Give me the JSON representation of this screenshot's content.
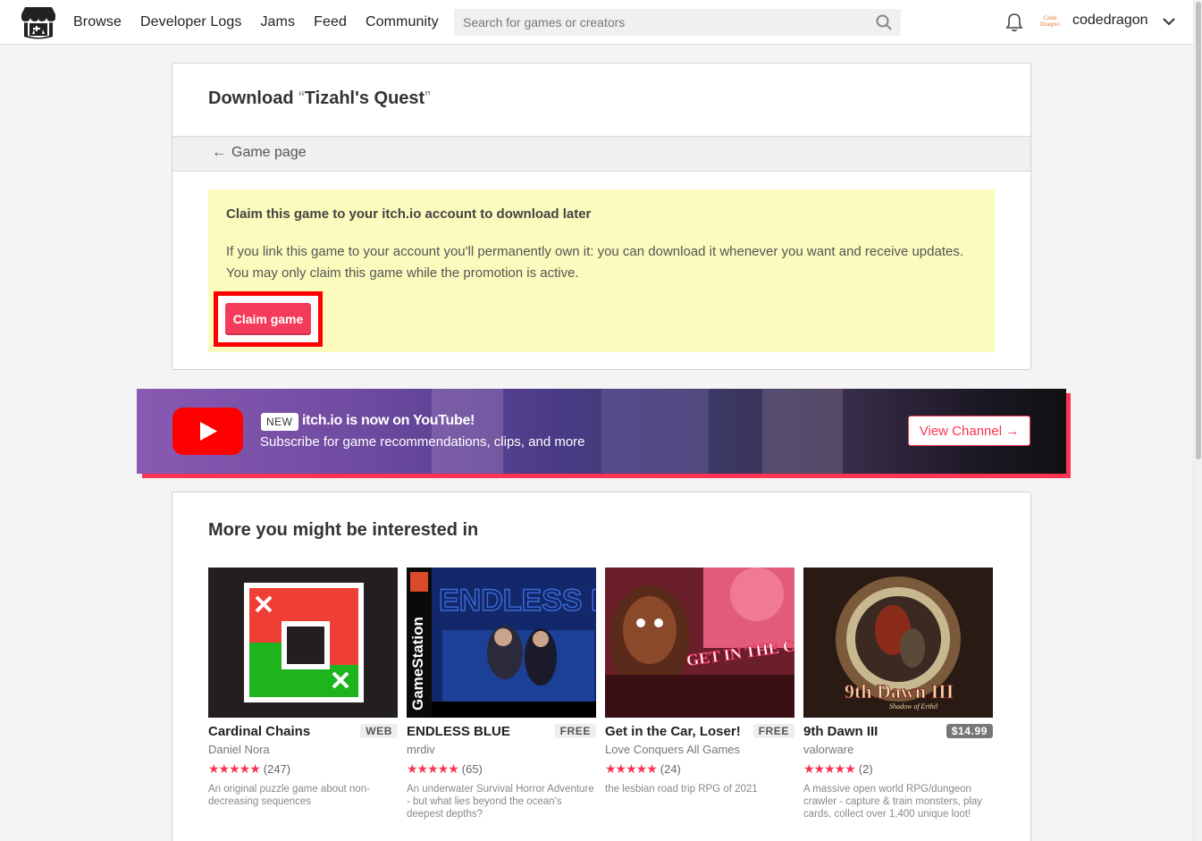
{
  "header": {
    "nav": [
      "Browse",
      "Developer Logs",
      "Jams",
      "Feed",
      "Community"
    ],
    "search_placeholder": "Search for games or creators",
    "avatar_text": "Code Dragon",
    "username": "codedragon"
  },
  "download": {
    "title_prefix": "Download",
    "open_quote": "“",
    "game_name": "Tizahl's Quest",
    "close_quote": "”",
    "back_label": "Game page",
    "claim_heading": "Claim this game to your itch.io account to download later",
    "claim_text": "If you link this game to your account you'll permanently own it: you can download it whenever you want and receive updates. You may only claim this game while the promotion is active.",
    "claim_button": "Claim game"
  },
  "youtube": {
    "badge": "NEW",
    "title": "itch.io is now on YouTube!",
    "subtitle": "Subscribe for game recommendations, clips, and more",
    "button": "View Channel →"
  },
  "recommendations": {
    "title": "More you might be interested in",
    "games": [
      {
        "title": "Cardinal Chains",
        "tag": "WEB",
        "author": "Daniel Nora",
        "rating_count": "(247)",
        "description": "An original puzzle game about non-decreasing sequences"
      },
      {
        "title": "ENDLESS BLUE",
        "tag": "FREE",
        "author": "mrdiv",
        "rating_count": "(65)",
        "description": "An underwater Survival Horror Adventure - but what lies beyond the ocean's deepest depths?"
      },
      {
        "title": "Get in the Car, Loser!",
        "tag": "FREE",
        "author": "Love Conquers All Games",
        "rating_count": "(24)",
        "description": "the lesbian road trip RPG of 2021"
      },
      {
        "title": "9th Dawn III",
        "tag": "$14.99",
        "author": "valorware",
        "rating_count": "(2)",
        "description": "A massive open world RPG/dungeon crawler - capture & train monsters, play cards, collect over 1,400 unique loot!"
      }
    ],
    "thumb_text": {
      "endless_blue": "ENDLESS BLUE",
      "gamestation": "GameStation",
      "car_loser": "GET IN THE CAR, LOSER!",
      "ninth_dawn": "9th Dawn III",
      "ninth_dawn_sub": "Shadow of Erthil"
    }
  },
  "colors": {
    "accent": "#fa3452",
    "claim_bg": "#fbfbbd",
    "highlight_outline": "#ff0000"
  }
}
